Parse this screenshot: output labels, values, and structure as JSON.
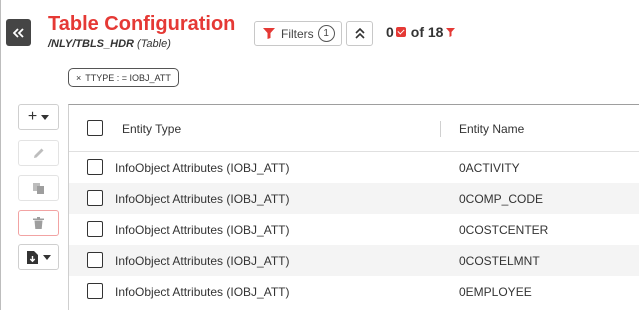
{
  "header": {
    "title": "Table Configuration",
    "subtitle_path": "/NLY/TBLS_HDR",
    "subtitle_type": "(Table)"
  },
  "filters": {
    "label": "Filters",
    "count": "1"
  },
  "counter": {
    "selected": "0",
    "of_label": "of 18"
  },
  "active_filter": {
    "text": "TTYPE : = IOBJ_ATT"
  },
  "grid": {
    "columns": [
      "Entity Type",
      "Entity Name"
    ],
    "rows": [
      {
        "type": "InfoObject Attributes (IOBJ_ATT)",
        "name": "0ACTIVITY"
      },
      {
        "type": "InfoObject Attributes (IOBJ_ATT)",
        "name": "0COMP_CODE"
      },
      {
        "type": "InfoObject Attributes (IOBJ_ATT)",
        "name": "0COSTCENTER"
      },
      {
        "type": "InfoObject Attributes (IOBJ_ATT)",
        "name": "0COSTELMNT"
      },
      {
        "type": "InfoObject Attributes (IOBJ_ATT)",
        "name": "0EMPLOYEE"
      }
    ]
  },
  "colors": {
    "accent": "#e53935",
    "dark_button": "#454545",
    "row_alt": "#f4f4f4"
  }
}
